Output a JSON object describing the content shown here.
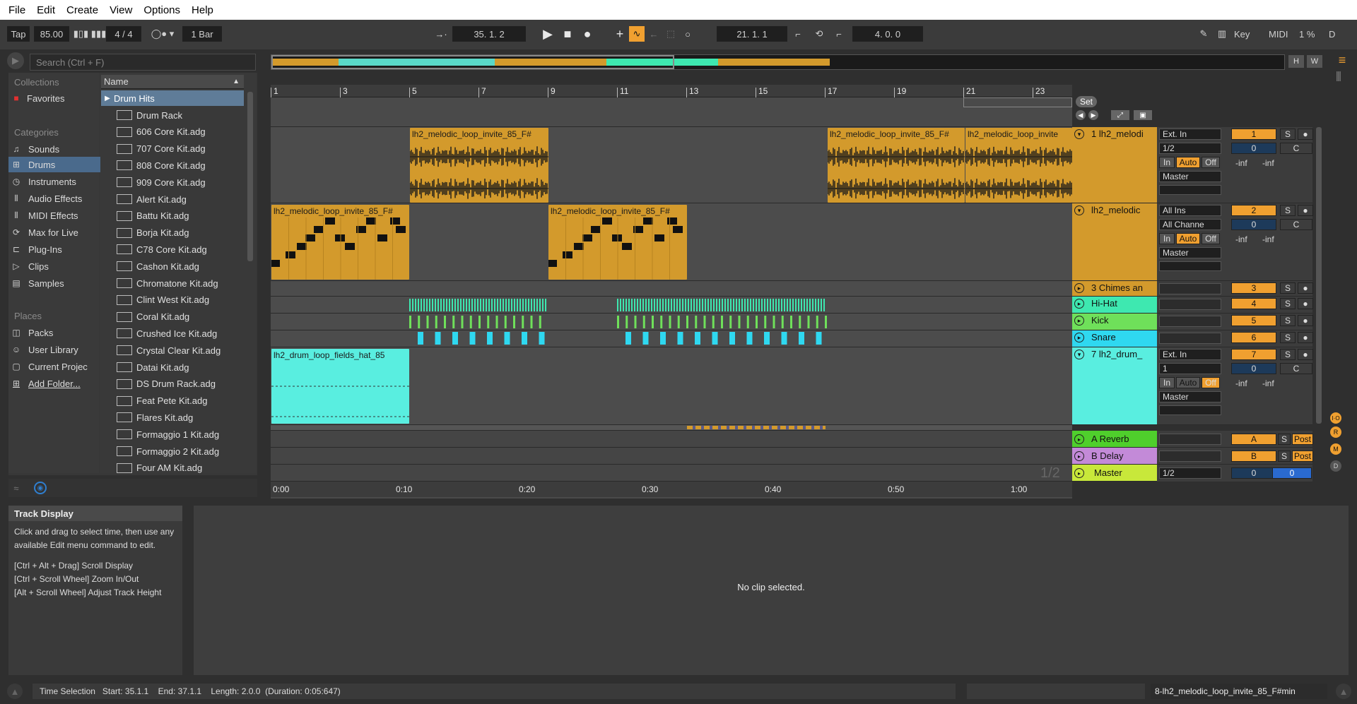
{
  "menu": [
    "File",
    "Edit",
    "Create",
    "View",
    "Options",
    "Help"
  ],
  "transport": {
    "tap": "Tap",
    "tempo": "85.00",
    "time_sig": "4 / 4",
    "quant": "1 Bar",
    "position": "35.  1.  2",
    "loop_start": "21.  1.  1",
    "loop_length": "4.  0.  0",
    "key": "Key",
    "midi": "MIDI",
    "cpu": "1 %",
    "d": "D"
  },
  "browser": {
    "search_placeholder": "Search (Ctrl + F)",
    "collections_header": "Collections",
    "favorites": "Favorites",
    "categories_header": "Categories",
    "categories": [
      "Sounds",
      "Drums",
      "Instruments",
      "Audio Effects",
      "MIDI Effects",
      "Max for Live",
      "Plug-Ins",
      "Clips",
      "Samples"
    ],
    "places_header": "Places",
    "places": [
      "Packs",
      "User Library",
      "Current Projec",
      "Add Folder..."
    ],
    "name_header": "Name",
    "folder": "Drum Hits",
    "files": [
      "Drum Rack",
      "606 Core Kit.adg",
      "707 Core Kit.adg",
      "808 Core Kit.adg",
      "909 Core Kit.adg",
      "Alert Kit.adg",
      "Battu Kit.adg",
      "Borja Kit.adg",
      "C78 Core Kit.adg",
      "Cashon Kit.adg",
      "Chromatone Kit.adg",
      "Clint West Kit.adg",
      "Coral Kit.adg",
      "Crushed Ice Kit.adg",
      "Crystal Clear Kit.adg",
      "Datai Kit.adg",
      "DS Drum Rack.adg",
      "Feat Pete Kit.adg",
      "Flares Kit.adg",
      "Formaggio 1 Kit.adg",
      "Formaggio 2 Kit.adg",
      "Four AM Kit.adg"
    ]
  },
  "ruler": [
    "1",
    "3",
    "5",
    "7",
    "9",
    "11",
    "13",
    "15",
    "17",
    "19",
    "21",
    "23"
  ],
  "set_label": "Set",
  "clips": {
    "c1a": "lh2_melodic_loop_invite_85_F#",
    "c1b": "lh2_melodic_loop_invite_85_F#",
    "c1c": "lh2_melodic_loop_invite",
    "c2a": "lh2_melodic_loop_invite_85_F#",
    "c2b": "lh2_melodic_loop_invite_85_F#",
    "c7": "lh2_drum_loop_fields_hat_85"
  },
  "tracks": [
    {
      "name": "1 lh2_melodi",
      "color": "#d39a2c",
      "input": "Ext. In",
      "channel": "1/2",
      "out": "Master",
      "num": "1",
      "vol": "0",
      "pan": "C"
    },
    {
      "name": "lh2_melodic",
      "color": "#d39a2c",
      "input": "All Ins",
      "channel": "All Channe",
      "out": "Master",
      "num": "2",
      "vol": "0",
      "pan": "C"
    },
    {
      "name": "3 Chimes an",
      "color": "#d39a2c",
      "num": "3"
    },
    {
      "name": "Hi-Hat",
      "color": "#3ee8b0",
      "num": "4"
    },
    {
      "name": "Kick",
      "color": "#6fe05a",
      "num": "5"
    },
    {
      "name": "Snare",
      "color": "#2fd8f0",
      "num": "6"
    },
    {
      "name": "7 lh2_drum_",
      "color": "#59eee0",
      "input": "Ext. In",
      "channel": "1",
      "out": "Master",
      "num": "7",
      "vol": "0",
      "pan": "C"
    }
  ],
  "returns": [
    {
      "name": "A Reverb",
      "color": "#4fcf2c",
      "letter": "A",
      "post": "Post"
    },
    {
      "name": "B Delay",
      "color": "#c38ad8",
      "letter": "B",
      "post": "Post"
    }
  ],
  "master": {
    "name": "Master",
    "channel": "1/2",
    "vol": "0",
    "vol2": "0"
  },
  "mixer_labels": {
    "in": "In",
    "auto": "Auto",
    "off": "Off",
    "inf": "-inf",
    "s": "S"
  },
  "page_indicator": "1/2",
  "time_ruler": [
    "0:00",
    "0:10",
    "0:20",
    "0:30",
    "0:40",
    "0:50",
    "1:00"
  ],
  "info": {
    "title": "Track Display",
    "body": "Click and drag to select time, then use any available Edit menu command to edit.",
    "hint1": "[Ctrl + Alt + Drag] Scroll Display",
    "hint2": "[Ctrl + Scroll Wheel] Zoom In/Out",
    "hint3": "[Alt + Scroll Wheel] Adjust Track Height"
  },
  "detail_empty": "No clip selected.",
  "status": {
    "text": "Time Selection   Start: 35.1.1    End: 37.1.1    Length: 2.0.0  (Duration: 0:05:647)",
    "clip": "8-lh2_melodic_loop_invite_85_F#min"
  },
  "colors": {
    "orange": "#d39a2c",
    "cyan": "#59eee0",
    "accent": "#f0a030"
  }
}
